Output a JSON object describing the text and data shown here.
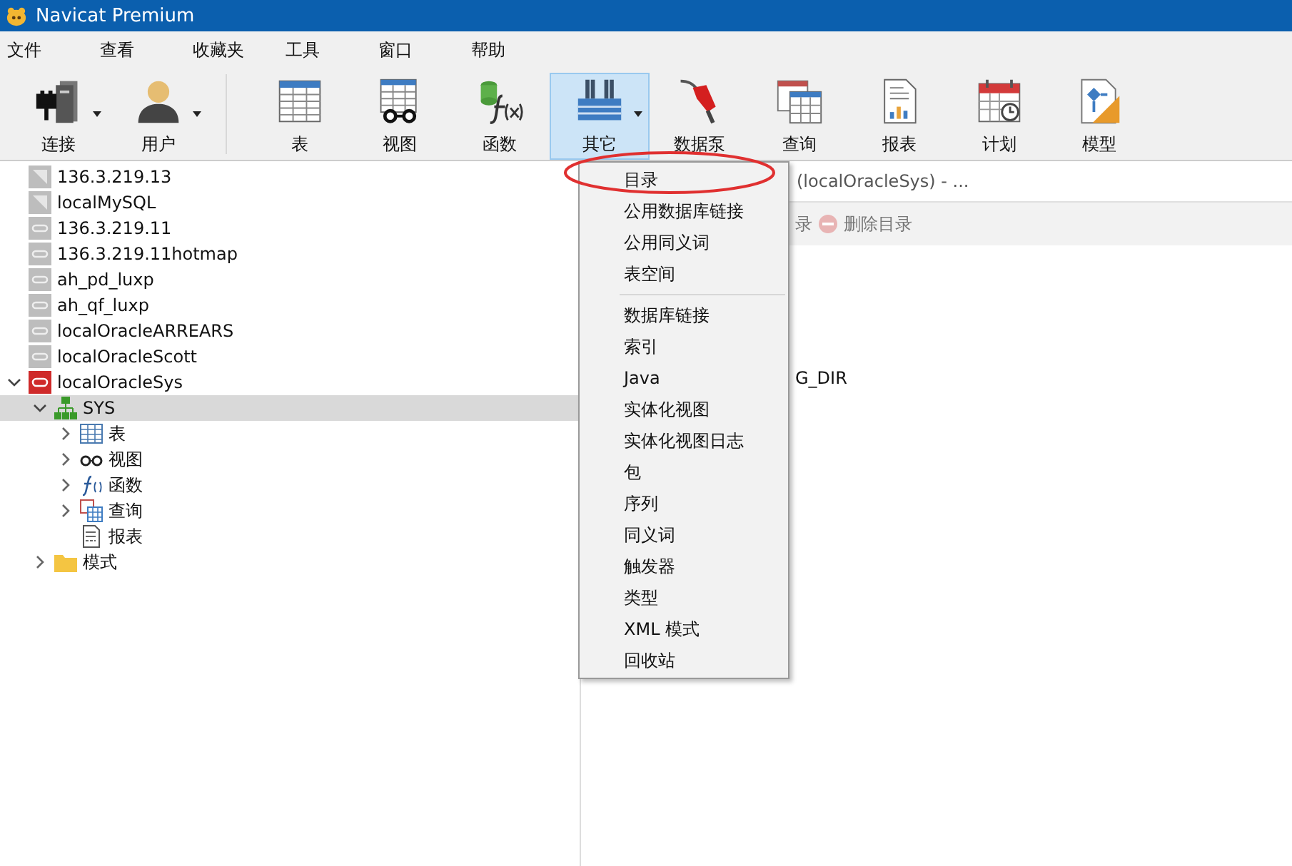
{
  "window": {
    "title": "Navicat Premium"
  },
  "menu_bar": [
    "文件",
    "查看",
    "收藏夹",
    "工具",
    "窗口",
    "帮助"
  ],
  "toolbar": [
    {
      "label": "连接",
      "kind": "connect",
      "dropdown": true,
      "selected": false
    },
    {
      "label": "用户",
      "kind": "user",
      "dropdown": true,
      "selected": false
    },
    {
      "kind": "separator"
    },
    {
      "label": "表",
      "kind": "table",
      "dropdown": false,
      "selected": false
    },
    {
      "label": "视图",
      "kind": "view",
      "dropdown": false,
      "selected": false
    },
    {
      "label": "函数",
      "kind": "function",
      "dropdown": false,
      "selected": false
    },
    {
      "label": "其它",
      "kind": "tools",
      "dropdown": true,
      "selected": true
    },
    {
      "label": "数据泵",
      "kind": "pump",
      "dropdown": false,
      "selected": false
    },
    {
      "label": "查询",
      "kind": "query",
      "dropdown": false,
      "selected": false
    },
    {
      "label": "报表",
      "kind": "report",
      "dropdown": false,
      "selected": false
    },
    {
      "label": "计划",
      "kind": "schedule",
      "dropdown": false,
      "selected": false
    },
    {
      "label": "模型",
      "kind": "model",
      "dropdown": false,
      "selected": false
    }
  ],
  "tree": [
    {
      "label": "136.3.219.13",
      "kind": "mysql",
      "selected": false
    },
    {
      "label": "localMySQL",
      "kind": "mysql",
      "selected": false
    },
    {
      "label": "136.3.219.11",
      "kind": "oracle",
      "selected": false
    },
    {
      "label": "136.3.219.11hotmap",
      "kind": "oracle",
      "selected": false
    },
    {
      "label": "ah_pd_luxp",
      "kind": "oracle",
      "selected": false
    },
    {
      "label": "ah_qf_luxp",
      "kind": "oracle",
      "selected": false
    },
    {
      "label": "localOracleARREARS",
      "kind": "oracle",
      "selected": false
    },
    {
      "label": "localOracleScott",
      "kind": "oracle",
      "selected": false
    },
    {
      "label": "localOracleSys",
      "kind": "oracle-open",
      "expanded": true,
      "selected": false,
      "children": [
        {
          "label": "SYS",
          "kind": "schema",
          "expanded": true,
          "selected": true,
          "children": [
            {
              "label": "表",
              "kind": "table",
              "expanded": false,
              "selected": false
            },
            {
              "label": "视图",
              "kind": "view",
              "expanded": false,
              "selected": false
            },
            {
              "label": "函数",
              "kind": "function",
              "expanded": false,
              "selected": false
            },
            {
              "label": "查询",
              "kind": "query",
              "expanded": false,
              "selected": false
            },
            {
              "label": "报表",
              "kind": "report",
              "selected": false
            }
          ]
        },
        {
          "label": "模式",
          "kind": "folder",
          "expanded": false,
          "selected": false
        }
      ]
    }
  ],
  "right_panel": {
    "tab_title": "(localOracleSys) - ...",
    "toolbar": [
      "录",
      "删除目录"
    ],
    "rows": [
      "G_DIR"
    ]
  },
  "dropdown_menu": {
    "groups": [
      [
        "目录",
        "公用数据库链接",
        "公用同义词",
        "表空间"
      ],
      [
        "数据库链接",
        "索引",
        "Java",
        "实体化视图",
        "实体化视图日志",
        "包",
        "序列",
        "同义词",
        "触发器",
        "类型",
        "XML 模式",
        "回收站"
      ]
    ]
  }
}
